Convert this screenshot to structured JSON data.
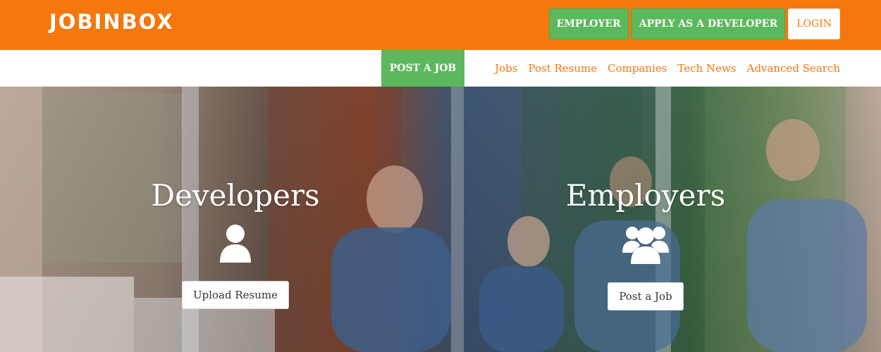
{
  "header": {
    "logo": "JOBINBOX",
    "employer_label": "EMPLOYER",
    "apply_label": "APPLY AS A DEVELOPER",
    "login_label": "LOGIN"
  },
  "nav": {
    "post_job_label": "POST A JOB",
    "links": [
      "Jobs",
      "Post Resume",
      "Companies",
      "Tech News",
      "Advanced Search"
    ]
  },
  "hero": {
    "developers": {
      "title": "Developers",
      "icon": "user-icon",
      "button_label": "Upload Resume"
    },
    "employers": {
      "title": "Employers",
      "icon": "group-icon",
      "button_label": "Post a Job"
    }
  },
  "colors": {
    "brand_orange": "#f6770b",
    "green": "#5cb85c"
  }
}
